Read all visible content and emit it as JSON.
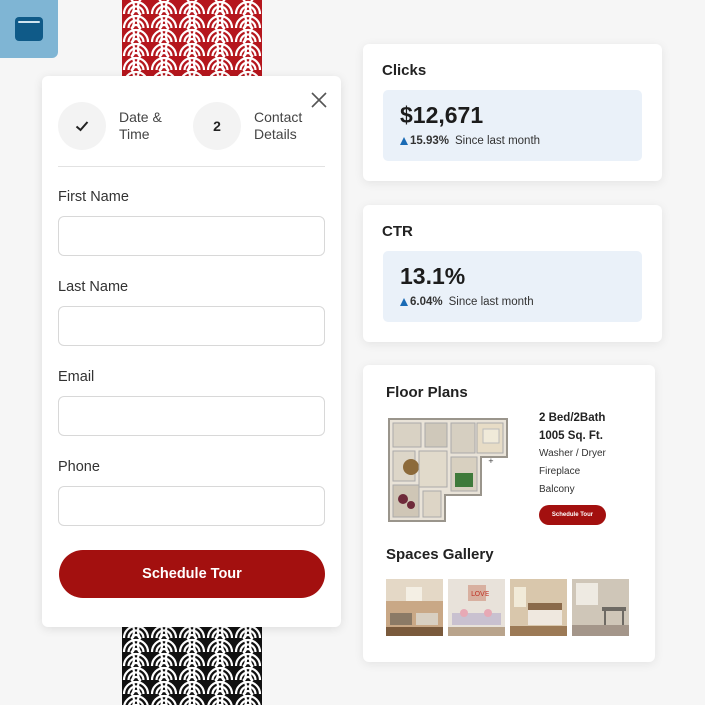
{
  "app_icon": "browser-window-icon",
  "form": {
    "steps": [
      {
        "marker": "✓",
        "label": "Date & Time",
        "icon": "check-icon"
      },
      {
        "marker": "2",
        "label": "Contact Details"
      }
    ],
    "fields": [
      {
        "label": "First Name",
        "value": "",
        "placeholder": ""
      },
      {
        "label": "Last Name",
        "value": "",
        "placeholder": ""
      },
      {
        "label": "Email",
        "value": "",
        "placeholder": ""
      },
      {
        "label": "Phone",
        "value": "",
        "placeholder": ""
      }
    ],
    "submit_label": "Schedule Tour",
    "close_icon": "close-icon"
  },
  "metrics": [
    {
      "title": "Clicks",
      "value": "$12,671",
      "change": "15.93%",
      "period": "Since last month"
    },
    {
      "title": "CTR",
      "value": "13.1%",
      "change": "6.04%",
      "period": "Since last month"
    }
  ],
  "floor_plans": {
    "title": "Floor Plans",
    "plan": {
      "name": "2 Bed/2Bath",
      "size": "1005 Sq. Ft.",
      "features": [
        "Washer / Dryer",
        "Fireplace",
        "Balcony"
      ],
      "button_label": "Schedule Tour"
    },
    "gallery_title": "Spaces Gallery",
    "gallery": [
      "living-room-photo",
      "lounge-photo",
      "bedroom-photo",
      "dining-room-photo"
    ]
  },
  "colors": {
    "brand_red": "#a3100f",
    "accent_blue": "#1a6bb5",
    "metric_bg": "#eaf1f9",
    "icon_bg": "#7fb5d4"
  }
}
